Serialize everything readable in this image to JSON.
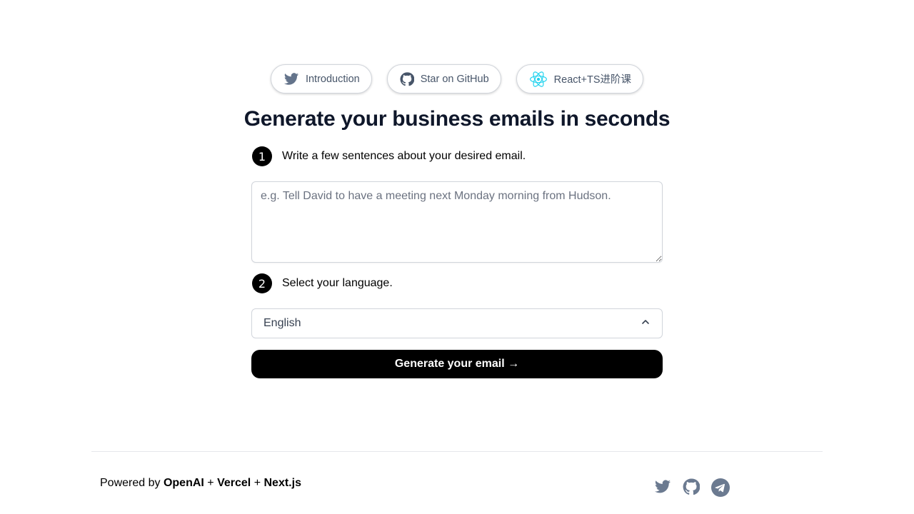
{
  "top_links": {
    "introduction": "Introduction",
    "github": "Star on GitHub",
    "course": "React+TS进阶课"
  },
  "title": "Generate your business emails in seconds",
  "step1": {
    "number": "1",
    "label": "Write a few sentences about your desired email."
  },
  "prompt_input": {
    "value": "",
    "placeholder": "e.g. Tell David to have a meeting next Monday morning from Hudson."
  },
  "step2": {
    "number": "2",
    "label": "Select your language."
  },
  "language_select": {
    "selected": "English"
  },
  "generate_button": "Generate your email →",
  "footer": {
    "powered_by": "Powered by",
    "brand1": "OpenAI",
    "plus1": "+",
    "brand2": "Vercel",
    "plus2": "+",
    "brand3": "Next.js"
  },
  "icons": {
    "twitter": "twitter-icon",
    "github": "github-icon",
    "react": "react-icon",
    "telegram": "telegram-icon",
    "chevron": "chevron-up-icon"
  },
  "colors": {
    "accent": "#000000",
    "icon_gray": "#6b7a90",
    "react_blue": "#22d3ee"
  }
}
